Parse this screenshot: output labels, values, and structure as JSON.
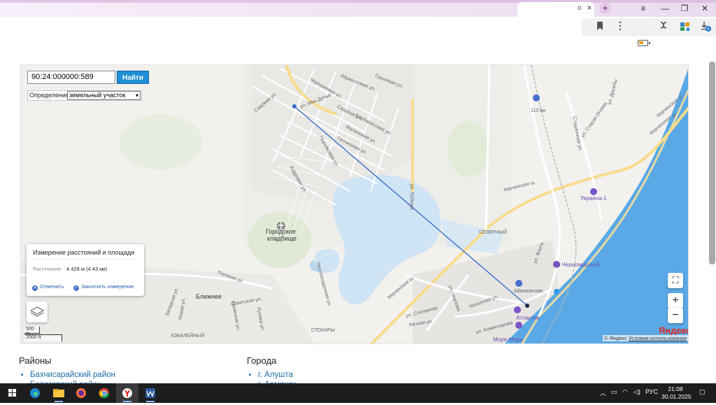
{
  "browser": {
    "tab_scroll": "o",
    "tab_close": "×",
    "new_tab": "+",
    "menu": "≡",
    "minimize": "—",
    "maximize": "❐",
    "close": "✕",
    "download_badge": "6"
  },
  "map": {
    "cadastral_input": "90:24:000000:589",
    "find_button": "Найти",
    "definition_label": "Определение:",
    "definition_value": "земельный участок",
    "measure": {
      "title": "Измерение расстояний и площади",
      "distance_label": "Расстояние",
      "distance_value": "4 428 м (4.43 км)",
      "cancel": "Отменить",
      "finish": "Закончить измерение"
    },
    "scale_1": "500 m",
    "scale_2": "2000 ft",
    "logo": "Яндекс",
    "copyright_prefix": "© Яндекс",
    "terms": "Условия использования",
    "zoom_in": "+",
    "zoom_out": "−",
    "fullscreen": "⛶",
    "labels": {
      "cemetery_1": "Городское",
      "cemetery_2": "кладбище",
      "blizhnee": "Ближнее",
      "severny": "СЕВЕРНЫЙ",
      "stokary": "СТОКАРЫ",
      "yubileyny": "ЮБИЛЕЙНЫЙ",
      "kerch_1": "Керченское ш.",
      "kerch_2": "Керченское ш.",
      "kerch_3": "Керченское ш.",
      "kerch_4": "Керченское ш.",
      "km113": "113 км",
      "ukraina": "Украина-1",
      "na_chernomorskoy": "На Черноморской",
      "aivazovskaya": "Айвазовская",
      "atlantik": "Атлантик",
      "more_more": "Море-Море",
      "str_abrikos": "Абрикосовая ул.",
      "str_grush": "Грушевая ул.",
      "str_chereshn": "Черешневая ул.",
      "str_dunaya": "ул. Ивы Дунье",
      "str_sadovaya": "Садовая ул.",
      "str_sadovaya2": "Садовая ул.",
      "str_barbaris": "Барбарисовая ул.",
      "str_malin": "Малиновая ул.",
      "str_grech": "Гречишная ул.",
      "str_persik": "Персиковая ул.",
      "str_pobedy": "ул. Победы",
      "str_lesopos": "Лесопосадочная ул.",
      "str_stepanova": "ул. Степанова",
      "str_chkalova": "ул. Чкалова",
      "str_polevaya": "Полевая ул.",
      "str_sovetskaya": "Советская ул.",
      "str_lupova": "Лупова ул.",
      "str_krymskaya": "Крымская ул.",
      "str_komissarova": "ул. Комиссарова",
      "str_nasypnaya": "Насыпная ул.",
      "str_rechnaya": "Речная ул.",
      "str_druzhby": "ул. Дружбы",
      "str_flota": "ул. Флота",
      "str_ogneva": "ул. Старая Огнева",
      "str_stadion": "Стадионная ул.",
      "str_kedr": "Кедровая ул.",
      "str_zapad": "Западная ул.",
      "str_novaya": "Новая ул."
    }
  },
  "sections": {
    "districts_title": "Районы",
    "districts": [
      "Бахчисарайский район",
      "Белогорский район"
    ],
    "cities_title": "Города",
    "cities": [
      "г. Алушта",
      "г. Армянск"
    ]
  },
  "taskbar": {
    "tray_lang": "РУС",
    "time": "21:08",
    "date": "30.01.2025"
  },
  "colors": {
    "sea": "#5aa9e6",
    "measure_line": "#3a6fc8",
    "yandex_red": "#e1261c",
    "find_button": "#1e8fd6",
    "link": "#1d6fa8"
  }
}
